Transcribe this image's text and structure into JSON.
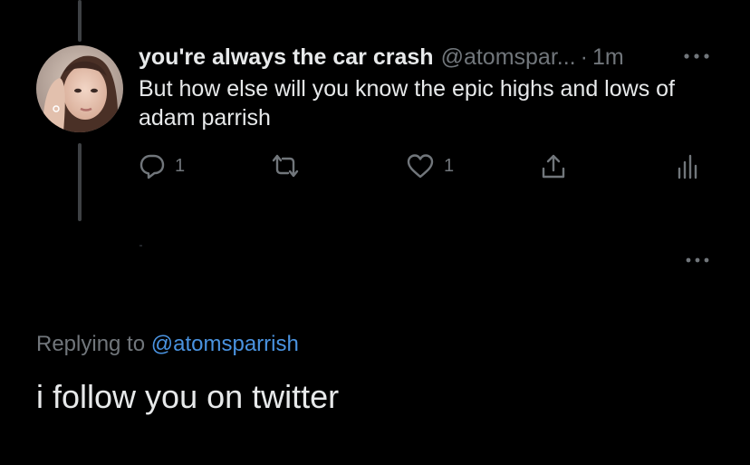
{
  "tweet": {
    "display_name": "you're always the car crash",
    "handle": "@atomspar...",
    "separator": "·",
    "time": "1m",
    "text": "But how else will you know the epic highs and lows of adam parrish",
    "reply_count": "1",
    "like_count": "1",
    "icons": {
      "reply": "reply-icon",
      "retweet": "retweet-icon",
      "like": "heart-icon",
      "share": "share-icon",
      "analytics": "analytics-icon",
      "more": "more-icon"
    }
  },
  "reply": {
    "replying_prefix": "Replying to",
    "replying_handle": "@atomsparrish",
    "text": "i follow you on twitter"
  },
  "colors": {
    "background": "#000000",
    "primary_text": "#e7e9ea",
    "secondary_text": "#71767b",
    "link": "#4a93e0",
    "thread_line": "#3e4144"
  }
}
